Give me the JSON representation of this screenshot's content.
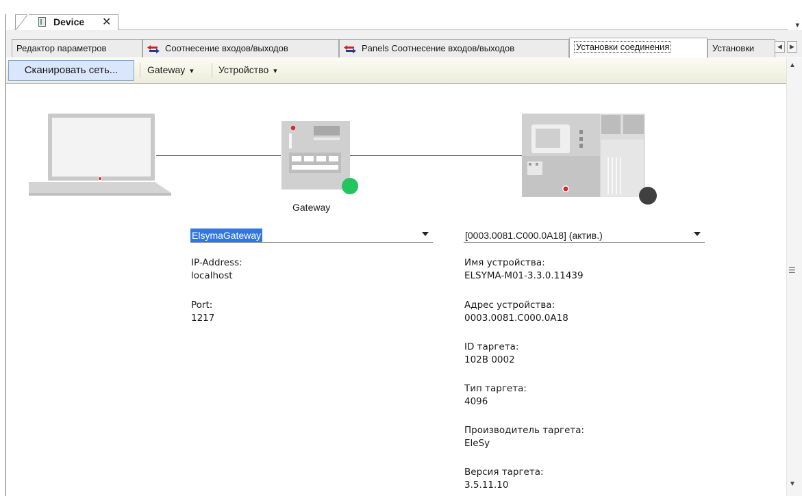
{
  "document_tab": {
    "title": "Device",
    "close": "✕",
    "overflow": "▾"
  },
  "tabs": [
    {
      "label": "Редактор параметров"
    },
    {
      "label": "Соотнесение входов/выходов"
    },
    {
      "label": "Panels Соотнесение входов/выходов"
    },
    {
      "label": "Установки соединения",
      "active": true
    },
    {
      "label": "Установки"
    }
  ],
  "tab_scroll": {
    "left": "◀",
    "right": "▶"
  },
  "toolbar": {
    "scan_label": "Сканировать сеть...",
    "gateway_label": "Gateway",
    "device_label": "Устройство",
    "caret": "▾"
  },
  "scrollbar": {
    "up": "▲",
    "grip": "☰",
    "down": "▼"
  },
  "diagram": {
    "gateway_caption": "Gateway",
    "gateway_status_color": "#22c55e",
    "device_status_color": "#404040",
    "laptop_led_color": "#d62828"
  },
  "gateway_panel": {
    "selected": "ElsymaGateway",
    "fields": [
      {
        "label": "IP-Address:",
        "value": "localhost"
      },
      {
        "label": "Port:",
        "value": "1217"
      }
    ]
  },
  "device_panel": {
    "selected": "[0003.0081.C000.0A18] (актив.)",
    "fields": [
      {
        "label": "Имя устройства:",
        "value": "ELSYMA-M01-3.3.0.11439"
      },
      {
        "label": "Адрес устройства:",
        "value": "0003.0081.C000.0A18"
      },
      {
        "label": "ID таргета:",
        "value": "102B  0002"
      },
      {
        "label": "Тип таргета:",
        "value": "4096"
      },
      {
        "label": "Производитель таргета:",
        "value": "EleSy"
      },
      {
        "label": "Версия таргета:",
        "value": "3.5.11.10"
      }
    ]
  }
}
